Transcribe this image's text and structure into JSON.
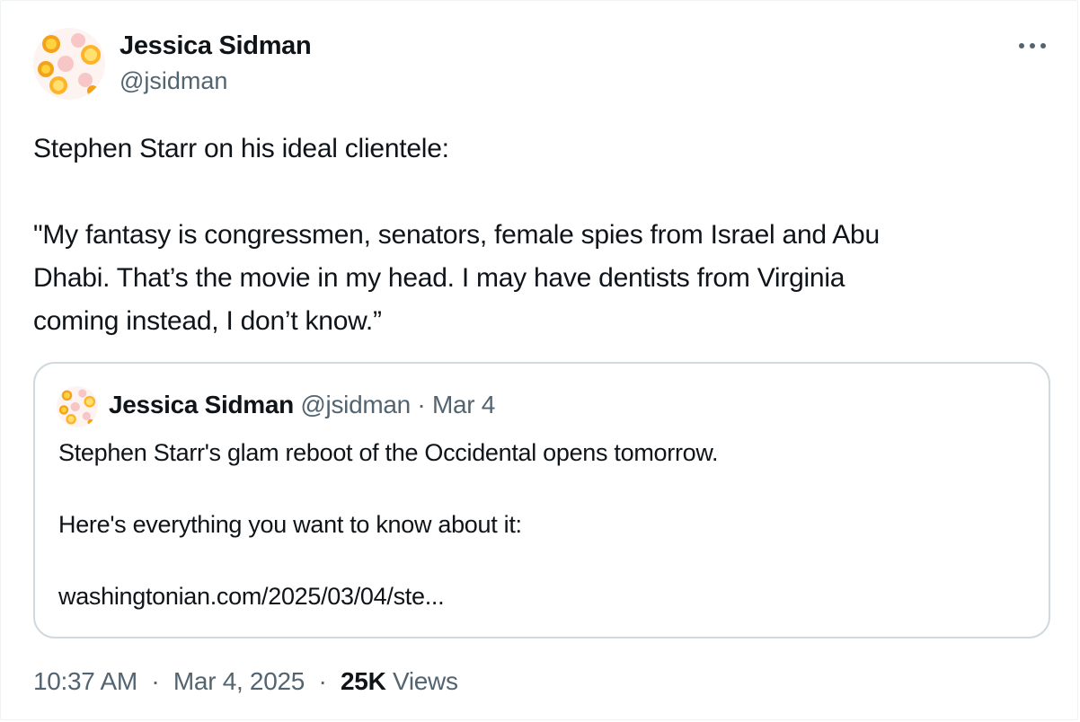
{
  "tweet": {
    "author_name": "Jessica Sidman",
    "author_handle": "@jsidman",
    "more_icon": "more-horizontal-icon",
    "text_line1": "Stephen Starr on his ideal clientele:",
    "text_line2": "\"My fantasy is congressmen, senators, female spies from Israel and Abu",
    "text_line3": "Dhabi. That’s the movie in my head. I may have dentists from Virginia",
    "text_line4": "coming instead, I don’t know.”"
  },
  "quoted_tweet": {
    "author_name": "Jessica Sidman",
    "author_handle": "@jsidman",
    "separator": "·",
    "date": "Mar 4",
    "text_line1": "Stephen Starr's glam reboot of the Occidental opens tomorrow.",
    "text_line2": "Here's everything you want to know about it:",
    "link": "washingtonian.com/2025/03/04/ste..."
  },
  "footer": {
    "time": "10:37 AM",
    "separator": "·",
    "date": "Mar 4, 2025",
    "views_count": "25K",
    "views_label": "Views"
  },
  "colors": {
    "text_primary": "#0f1419",
    "text_secondary": "#536471",
    "border": "#cfd9de",
    "avatar_orange": "#f5a21b",
    "avatar_yellow": "#ffd23f",
    "avatar_pink": "#f7c6c7"
  }
}
